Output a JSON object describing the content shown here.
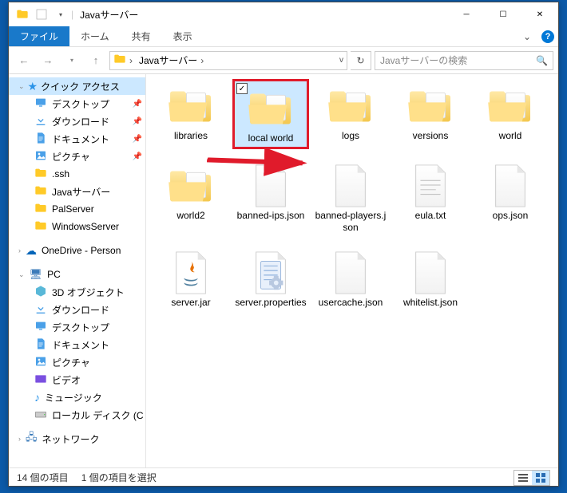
{
  "window": {
    "title": "Javaサーバー",
    "qat_separator": "|"
  },
  "ribbon": {
    "file": "ファイル",
    "home": "ホーム",
    "share": "共有",
    "view": "表示"
  },
  "addressbar": {
    "crumb": "Javaサーバー",
    "chevron": "›",
    "dropdown": "v"
  },
  "search": {
    "placeholder": "Javaサーバーの検索"
  },
  "nav": {
    "quick_access": "クイック アクセス",
    "items": [
      {
        "label": "デスクトップ",
        "icon": "desktop",
        "pinned": true
      },
      {
        "label": "ダウンロード",
        "icon": "download",
        "pinned": true
      },
      {
        "label": "ドキュメント",
        "icon": "document",
        "pinned": true
      },
      {
        "label": "ピクチャ",
        "icon": "picture",
        "pinned": true
      },
      {
        "label": ".ssh",
        "icon": "folder",
        "pinned": false
      },
      {
        "label": "Javaサーバー",
        "icon": "folder",
        "pinned": false
      },
      {
        "label": "PalServer",
        "icon": "folder",
        "pinned": false
      },
      {
        "label": "WindowsServer",
        "icon": "folder",
        "pinned": false
      }
    ],
    "onedrive": "OneDrive - Person",
    "pc": "PC",
    "pc_items": [
      {
        "label": "3D オブジェクト",
        "icon": "3d"
      },
      {
        "label": "ダウンロード",
        "icon": "download"
      },
      {
        "label": "デスクトップ",
        "icon": "desktop"
      },
      {
        "label": "ドキュメント",
        "icon": "document"
      },
      {
        "label": "ピクチャ",
        "icon": "picture"
      },
      {
        "label": "ビデオ",
        "icon": "video"
      },
      {
        "label": "ミュージック",
        "icon": "music"
      },
      {
        "label": "ローカル ディスク (C",
        "icon": "drive"
      }
    ],
    "network": "ネットワーク"
  },
  "content": {
    "items": [
      {
        "label": "libraries",
        "type": "folder-open",
        "selected": false
      },
      {
        "label": "local world",
        "type": "folder-open",
        "selected": true
      },
      {
        "label": "logs",
        "type": "folder-open",
        "selected": false
      },
      {
        "label": "versions",
        "type": "folder-open",
        "selected": false
      },
      {
        "label": "world",
        "type": "folder-open",
        "selected": false
      },
      {
        "label": "world2",
        "type": "folder-open",
        "selected": false
      },
      {
        "label": "banned-ips.json",
        "type": "json",
        "selected": false
      },
      {
        "label": "banned-players.json",
        "type": "json",
        "selected": false
      },
      {
        "label": "eula.txt",
        "type": "txt",
        "selected": false
      },
      {
        "label": "ops.json",
        "type": "json",
        "selected": false
      },
      {
        "label": "server.jar",
        "type": "jar",
        "selected": false
      },
      {
        "label": "server.properties",
        "type": "props",
        "selected": false
      },
      {
        "label": "usercache.json",
        "type": "json",
        "selected": false
      },
      {
        "label": "whitelist.json",
        "type": "json",
        "selected": false
      }
    ]
  },
  "status": {
    "count": "14 個の項目",
    "selected": "1 個の項目を選択"
  },
  "checkmark": "✓"
}
